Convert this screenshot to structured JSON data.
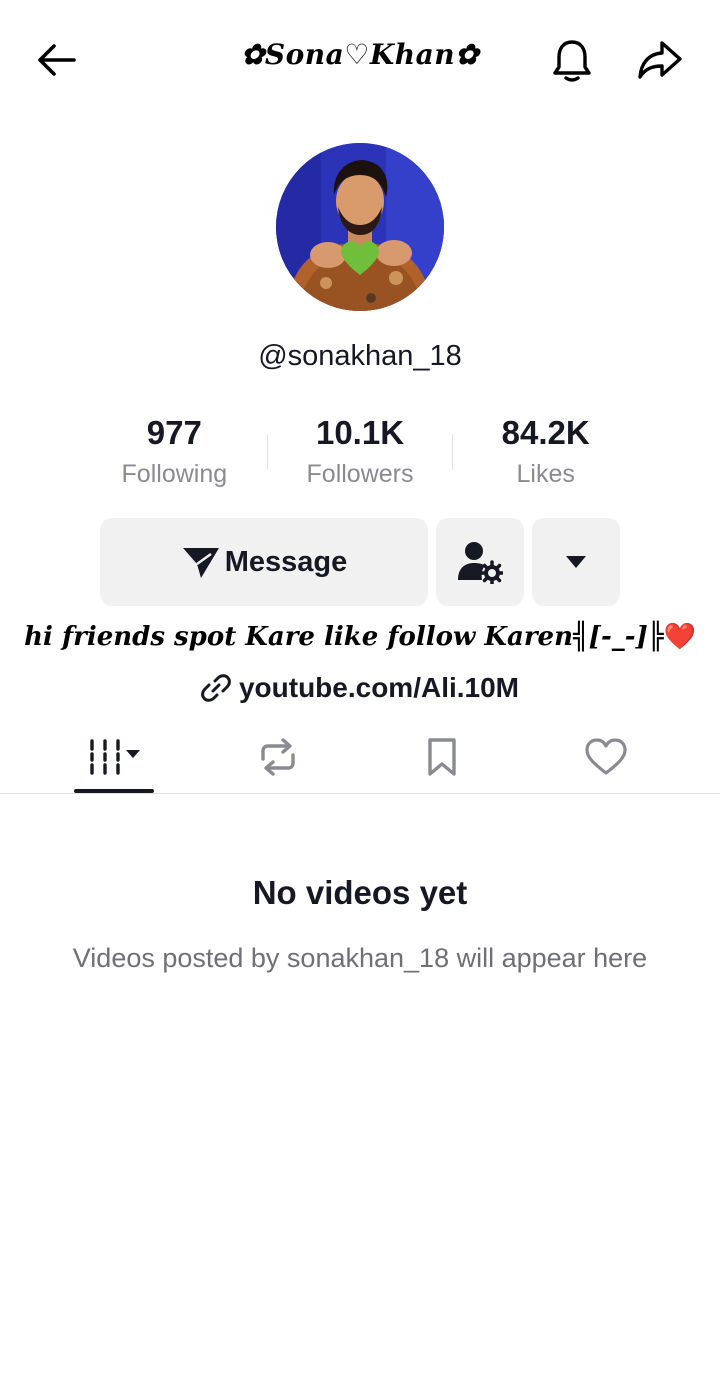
{
  "header": {
    "title": "✿𝑺𝒐𝒏𝒂♡𝑲𝒉𝒂𝒏✿",
    "back_icon": "arrow-left-icon",
    "bell_icon": "bell-icon",
    "share_icon": "share-arrow-icon"
  },
  "profile": {
    "username": "@sonakhan_18",
    "avatar_icon": "profile-photo"
  },
  "stats": [
    {
      "value": "977",
      "label": "Following"
    },
    {
      "value": "10.1K",
      "label": "Followers"
    },
    {
      "value": "84.2K",
      "label": "Likes"
    }
  ],
  "actions": {
    "message_label": "Message",
    "follow_settings_icon": "user-gear-icon",
    "more_icon": "caret-down-icon"
  },
  "bio": {
    "text": "hi friends spot Kare like follow Karen╣[-_-]╠",
    "heart": "❤️"
  },
  "link": {
    "text": "youtube.com/Ali.10M",
    "icon": "link-icon"
  },
  "tabs": [
    {
      "name": "videos",
      "icon": "grid-bars-icon",
      "active": true
    },
    {
      "name": "reposts",
      "icon": "repost-icon",
      "active": false
    },
    {
      "name": "favorites",
      "icon": "bookmark-icon",
      "active": false
    },
    {
      "name": "liked",
      "icon": "heart-icon",
      "active": false
    }
  ],
  "empty_state": {
    "title": "No videos yet",
    "description": "Videos posted by sonakhan_18 will appear here"
  },
  "colors": {
    "text": "#161823",
    "muted": "#8a8b91",
    "button_bg": "#f1f1f2",
    "heart": "#e11d2a"
  }
}
